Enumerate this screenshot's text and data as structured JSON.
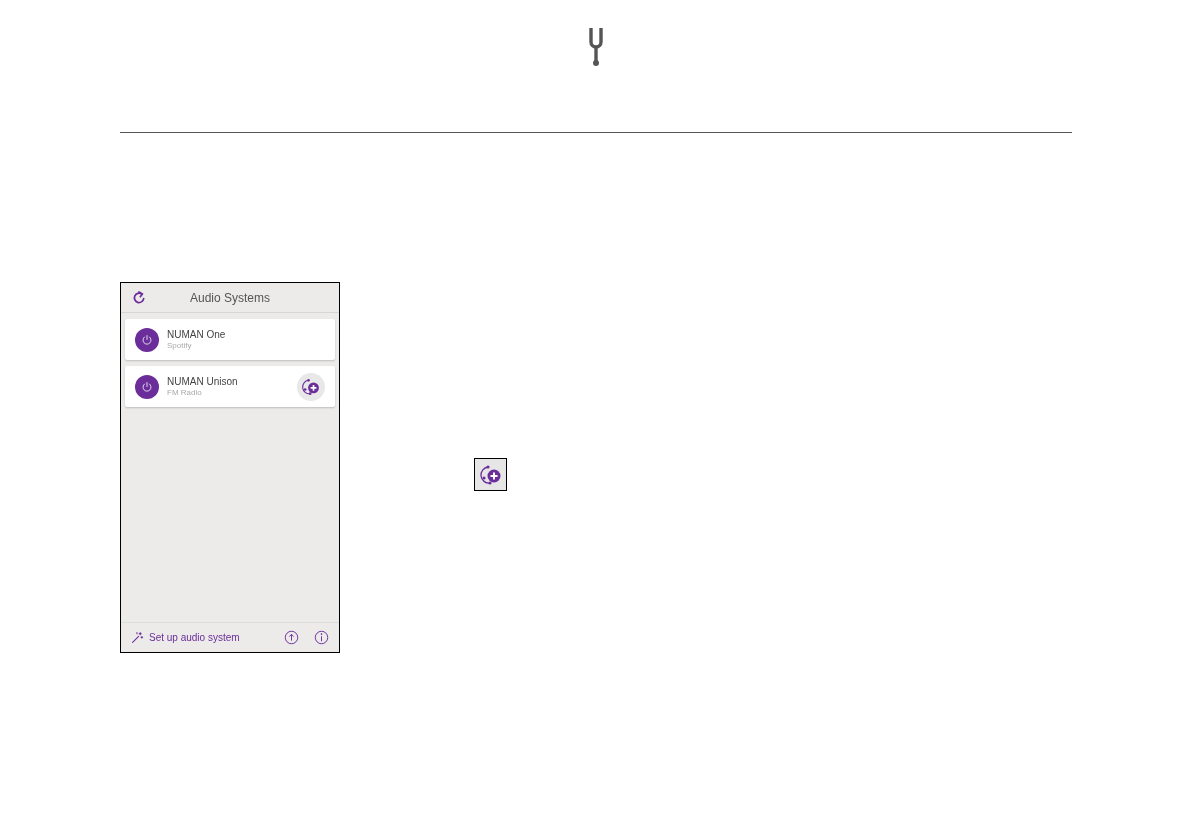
{
  "app": {
    "title": "Audio Systems",
    "systems": [
      {
        "name": "NUMAN One",
        "source": "Spotify",
        "group_button": false
      },
      {
        "name": "NUMAN Unison",
        "source": "FM Radio",
        "group_button": true
      }
    ],
    "footer": {
      "setup_label": "Set up audio system"
    }
  }
}
